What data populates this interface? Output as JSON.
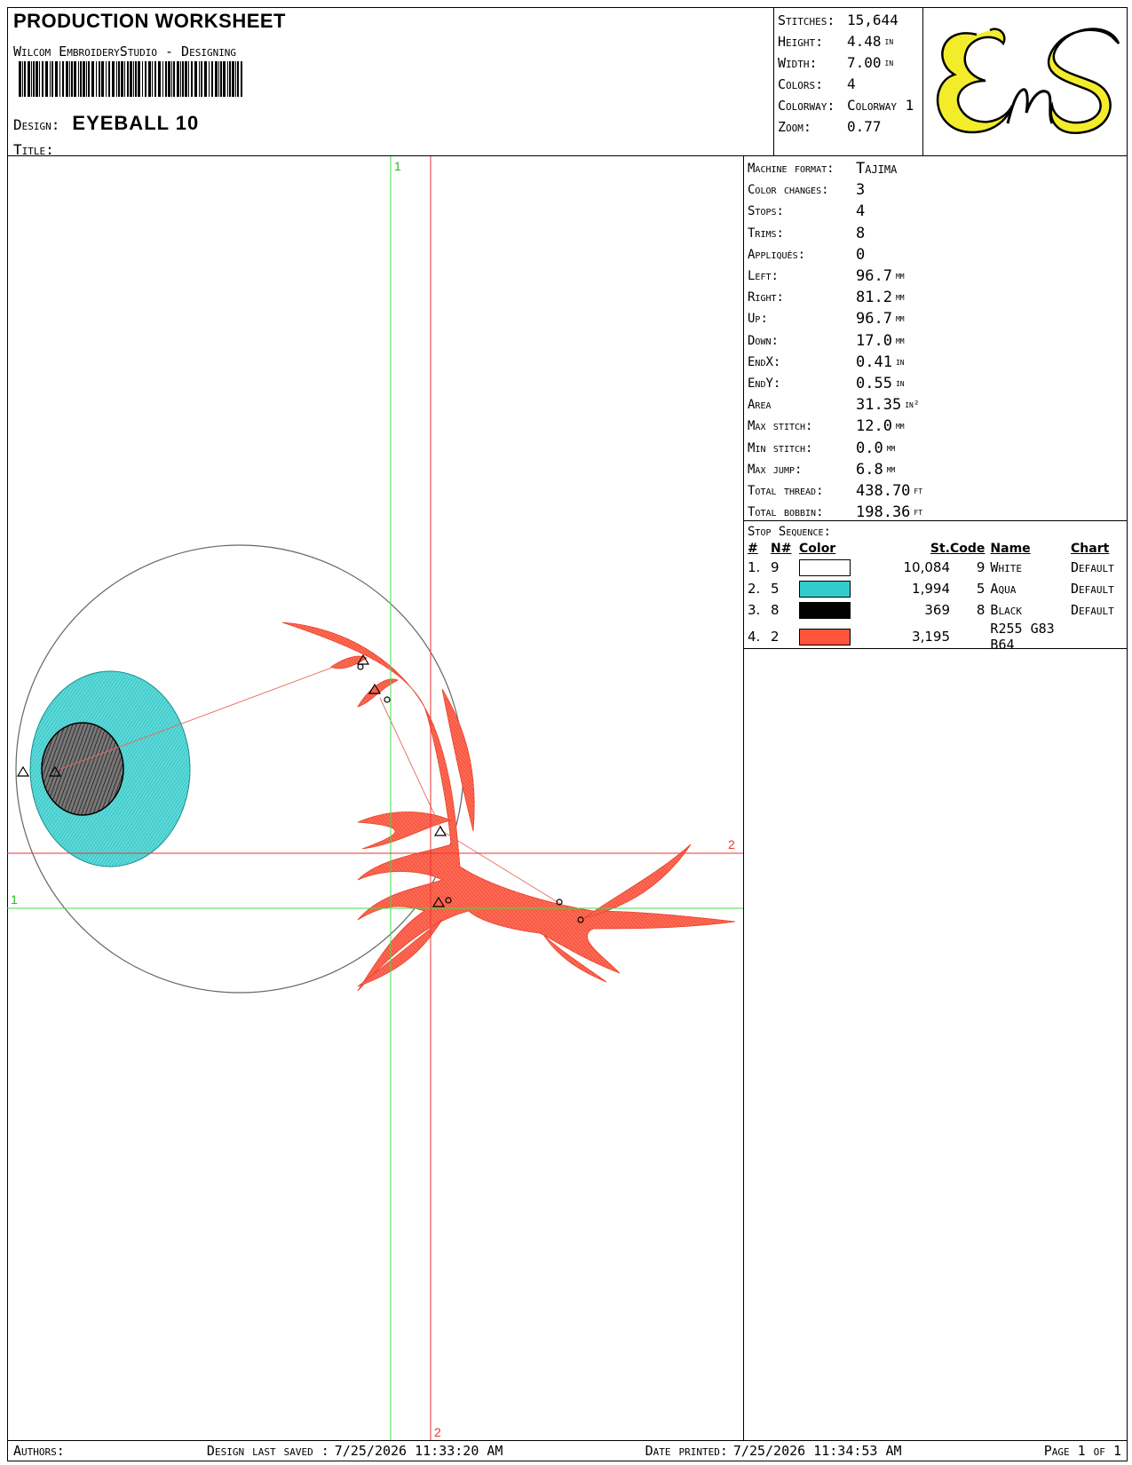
{
  "header": {
    "title": "PRODUCTION WORKSHEET",
    "subtitle": "Wilcom EmbroideryStudio - Designing",
    "design_label": "Design:",
    "design_value": "EYEBALL   10",
    "title_label": "Title:",
    "summary": [
      {
        "label": "Stitches:",
        "value": "15,644",
        "unit": ""
      },
      {
        "label": "Height:",
        "value": "4.48",
        "unit": "in"
      },
      {
        "label": "Width:",
        "value": "7.00",
        "unit": "in"
      },
      {
        "label": "Colors:",
        "value": "4",
        "unit": ""
      },
      {
        "label": "Colorway:",
        "value": "Colorway 1",
        "unit": ""
      },
      {
        "label": "Zoom:",
        "value": "0.77",
        "unit": ""
      }
    ],
    "logo_text": "EnS",
    "logo_color": "#f2ec2a"
  },
  "stats": [
    {
      "label": "Machine format:",
      "value": "Tajima",
      "unit": ""
    },
    {
      "label": "Color changes:",
      "value": "3",
      "unit": ""
    },
    {
      "label": "Stops:",
      "value": "4",
      "unit": ""
    },
    {
      "label": "Trims:",
      "value": "8",
      "unit": ""
    },
    {
      "label": "Appliqués:",
      "value": "0",
      "unit": ""
    },
    {
      "label": "Left:",
      "value": "96.7",
      "unit": "mm"
    },
    {
      "label": "Right:",
      "value": "81.2",
      "unit": "mm"
    },
    {
      "label": "Up:",
      "value": "96.7",
      "unit": "mm"
    },
    {
      "label": "Down:",
      "value": "17.0",
      "unit": "mm"
    },
    {
      "label": "EndX:",
      "value": "0.41",
      "unit": "in"
    },
    {
      "label": "EndY:",
      "value": "0.55",
      "unit": "in"
    },
    {
      "label": "Area",
      "value": "31.35",
      "unit": "in²"
    },
    {
      "label": "Max stitch:",
      "value": "12.0",
      "unit": "mm"
    },
    {
      "label": "Min stitch:",
      "value": "0.0",
      "unit": "mm"
    },
    {
      "label": "Max jump:",
      "value": "6.8",
      "unit": "mm"
    },
    {
      "label": "Total thread:",
      "value": "438.70",
      "unit": "ft"
    },
    {
      "label": "Total bobbin:",
      "value": "198.36",
      "unit": "ft"
    }
  ],
  "stop_sequence": {
    "title": "Stop Sequence:",
    "columns": {
      "num": "#",
      "needle": "N#",
      "color": "Color",
      "stitches": "St.",
      "code": "Code",
      "name": "Name",
      "chart": "Chart"
    },
    "rows": [
      {
        "num": "1.",
        "needle": "9",
        "swatch": "#ffffff",
        "stitches": "10,084",
        "code": "9",
        "name": "White",
        "chart": "Default"
      },
      {
        "num": "2.",
        "needle": "5",
        "swatch": "#33cccc",
        "stitches": "1,994",
        "code": "5",
        "name": "Aqua",
        "chart": "Default"
      },
      {
        "num": "3.",
        "needle": "8",
        "swatch": "#000000",
        "stitches": "369",
        "code": "8",
        "name": "Black",
        "chart": "Default"
      },
      {
        "num": "4.",
        "needle": "2",
        "swatch": "#ff533b",
        "stitches": "3,195",
        "code": "",
        "name": "R255 G83 B64",
        "chart": ""
      }
    ]
  },
  "canvas": {
    "guide_labels": {
      "green_v": "1",
      "green_h": "1",
      "red_v": "2",
      "red_h": "2"
    },
    "colors": {
      "aqua": "#33cccc",
      "pupil": "#2a2a2a",
      "vein": "#ff533b",
      "guide_green": "#44dd44",
      "guide_red": "#ee3333"
    }
  },
  "footer": {
    "authors_label": "Authors:",
    "saved_label": "Design last saved :",
    "saved_value": "7/25/2026 11:33:20 AM",
    "printed_label": "Date printed:",
    "printed_value": "7/25/2026 11:34:53 AM",
    "page_label": "Page 1 of 1"
  }
}
